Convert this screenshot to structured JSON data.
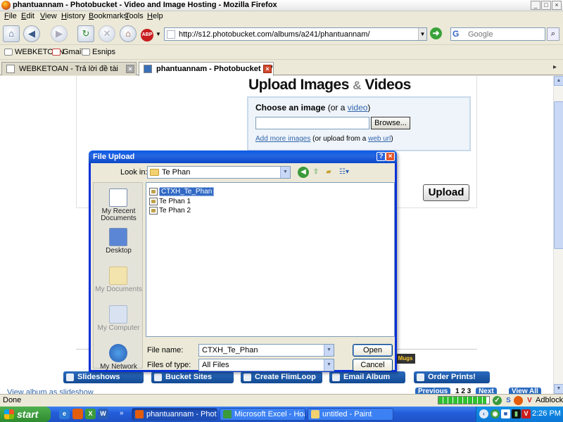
{
  "window": {
    "title": "phantuannam - Photobucket - Video and Image Hosting - Mozilla Firefox",
    "controls": {
      "minimize": "_",
      "maximize": "□",
      "close": "×"
    }
  },
  "menu": [
    "File",
    "Edit",
    "View",
    "History",
    "Bookmarks",
    "Tools",
    "Help"
  ],
  "navbar": {
    "url": "http://s12.photobucket.com/albums/a241/phantuannam/",
    "search_placeholder": "Google",
    "abp_label": "ABP"
  },
  "bookmarks": [
    "WEBKETOAN",
    "Gmail",
    "Esnips"
  ],
  "tabs": [
    {
      "label": "WEBKETOAN - Trả lời đề tài",
      "active": false
    },
    {
      "label": "phantuannam - Photobucket - Vi...",
      "active": true
    }
  ],
  "page": {
    "heading_part1": "Upload Images",
    "heading_amp": "&",
    "heading_part2": "Videos",
    "choose_label": "Choose an image",
    "choose_or": "(or a",
    "choose_video_link": "video",
    "choose_close": ")",
    "browse_label": "Browse...",
    "add_more_link": "Add more images",
    "add_more_mid": "(or upload from a",
    "web_url_link": "web url",
    "add_more_close": ")",
    "upload_label": "Upload",
    "mugs_label": "Mugs",
    "bottom_buttons": [
      "Slideshows",
      "Bucket Sites",
      "Create FlimLoop",
      "Email Album",
      "Order Prints!"
    ],
    "slideshow_link": "View album as slideshow",
    "prev_label": "Previous",
    "page_numbers": "1 2 3",
    "next_label": "Next",
    "view_all_label": "View All"
  },
  "statusbar": {
    "status": "Done",
    "progress_fraction": 0.95,
    "adblock": "Adblock"
  },
  "taskbar": {
    "start": "start",
    "buttons": [
      {
        "label": "phantuannam - Photo...",
        "active": true
      },
      {
        "label": "Microsoft Excel - Hoa ...",
        "active": false
      },
      {
        "label": "untitled - Paint",
        "active": false
      }
    ],
    "clock": "2:26 PM"
  },
  "dialog": {
    "title": "File Upload",
    "help": "?",
    "close": "×",
    "lookin_label": "Look in:",
    "lookin_value": "Te Phan",
    "places": [
      "My Recent Documents",
      "Desktop",
      "My Documents",
      "My Computer",
      "My Network"
    ],
    "files": [
      {
        "name": "CTXH_Te_Phan",
        "selected": true
      },
      {
        "name": "Te Phan 1",
        "selected": false
      },
      {
        "name": "Te Phan 2",
        "selected": false
      }
    ],
    "filename_label": "File name:",
    "filename_value": "CTXH_Te_Phan",
    "filetype_label": "Files of type:",
    "filetype_value": "All Files",
    "open_label": "Open",
    "cancel_label": "Cancel"
  }
}
